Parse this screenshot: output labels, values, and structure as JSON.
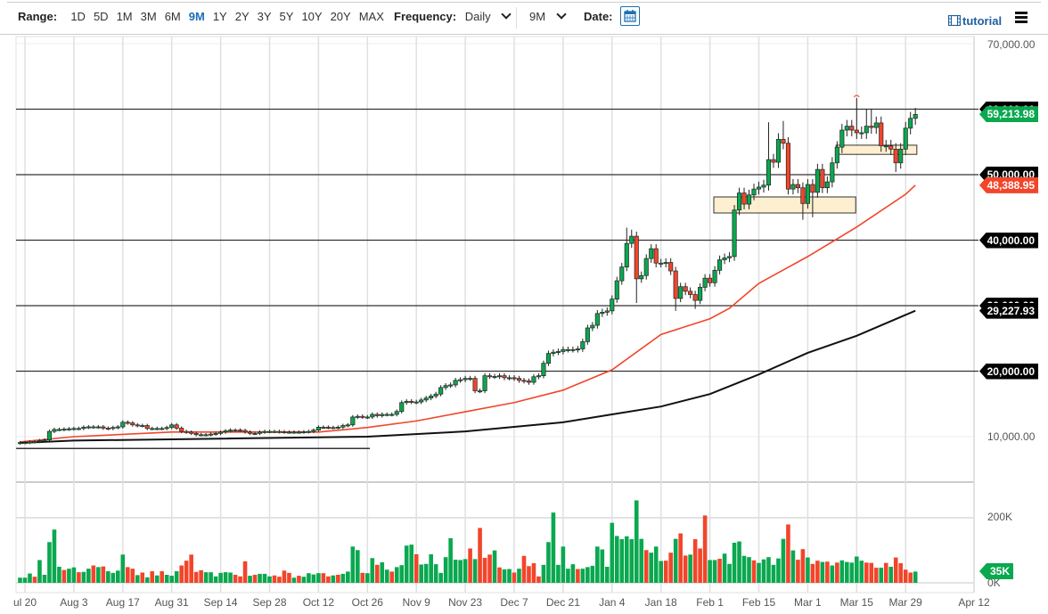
{
  "toolbar": {
    "range_label": "Range:",
    "range_options": [
      "1D",
      "5D",
      "1M",
      "3M",
      "6M",
      "9M",
      "1Y",
      "2Y",
      "3Y",
      "5Y",
      "10Y",
      "20Y",
      "MAX"
    ],
    "range_selected": "9M",
    "frequency_label": "Frequency:",
    "frequency_value": "Daily",
    "period_value": "9M",
    "date_label": "Date:",
    "tutorial_label": "tutorial"
  },
  "colors": {
    "up": "#0aa84f",
    "down": "#f2452a",
    "accent": "#1c6fb5",
    "ma50": "#f2452a",
    "ma200": "#111111"
  },
  "chart_data": {
    "type": "candlestick",
    "unit": "thousands USD",
    "ylim": [
      0,
      72
    ],
    "start_index": -1,
    "closes": [
      9.1,
      9.1,
      9.2,
      9.25,
      9.4,
      9.5,
      10.8,
      11.1,
      11.1,
      11.15,
      11.2,
      11.25,
      11.25,
      11.45,
      11.5,
      11.5,
      11.5,
      11.3,
      11.25,
      11.4,
      11.5,
      12.2,
      12.1,
      11.8,
      11.7,
      11.7,
      11.25,
      11.25,
      11.25,
      11.25,
      11.4,
      11.8,
      11.3,
      10.8,
      10.7,
      10.5,
      10.3,
      10.3,
      10.3,
      10.4,
      10.5,
      10.7,
      10.9,
      11.0,
      11.0,
      10.95,
      10.7,
      10.5,
      10.5,
      10.7,
      10.8,
      10.8,
      10.8,
      10.75,
      10.7,
      10.7,
      10.7,
      10.7,
      10.75,
      10.8,
      11.0,
      11.45,
      11.45,
      11.4,
      11.4,
      11.45,
      11.7,
      11.8,
      13.0,
      13.1,
      13.0,
      13.0,
      13.4,
      13.2,
      13.4,
      13.4,
      13.4,
      13.85,
      15.2,
      15.4,
      15.3,
      15.3,
      15.6,
      15.9,
      16.2,
      16.5,
      17.5,
      17.8,
      17.9,
      18.6,
      18.7,
      18.9,
      18.9,
      17.0,
      17.0,
      19.3,
      19.2,
      19.2,
      19.3,
      19.0,
      19.0,
      18.9,
      18.6,
      18.5,
      18.3,
      19.15,
      19.3,
      21.2,
      22.7,
      22.9,
      23.0,
      23.3,
      23.3,
      23.3,
      23.4,
      24.5,
      26.6,
      27.0,
      28.8,
      29.0,
      29.2,
      31.0,
      33.8,
      35.9,
      39.5,
      40.6,
      34.1,
      34.6,
      37.2,
      38.7,
      36.5,
      36.5,
      36.6,
      35.3,
      31.1,
      32.9,
      32.2,
      31.7,
      30.8,
      32.8,
      34.2,
      33.5,
      35.4,
      37.0,
      37.3,
      37.5,
      44.6,
      47.2,
      45.5,
      46.9,
      47.8,
      48.1,
      48.4,
      52.3,
      51.9,
      55.4,
      54.8,
      47.8,
      48.5,
      48.0,
      45.6,
      48.5,
      47.3,
      50.8,
      48.0,
      48.9,
      51.8,
      54.2,
      56.8,
      57.4,
      56.8,
      56.4,
      56.4,
      57.4,
      57.2,
      57.9,
      54.4,
      54.4,
      53.9,
      51.8,
      53.9,
      57.1,
      58.6,
      59.2
    ],
    "first_open": 9.0,
    "notable_highs": {
      "123": 41.9,
      "124": 41.6,
      "152": 58.0,
      "155": 58.2,
      "170": 61.7,
      "172": 60.0,
      "173": 60.0
    },
    "notable_lows": {
      "125": 30.4,
      "133": 29.2,
      "137": 29.5,
      "159": 43.1,
      "161": 43.5,
      "178": 50.4
    },
    "volume_unit": "K",
    "volumes": [
      16,
      16,
      29,
      19,
      71,
      25,
      127,
      166,
      50,
      40,
      44,
      48,
      33,
      34,
      44,
      54,
      49,
      51,
      36,
      31,
      38,
      88,
      49,
      44,
      24,
      32,
      17,
      36,
      23,
      36,
      25,
      22,
      36,
      54,
      69,
      88,
      34,
      39,
      33,
      33,
      20,
      31,
      33,
      32,
      25,
      20,
      67,
      22,
      25,
      28,
      28,
      20,
      23,
      19,
      38,
      31,
      16,
      22,
      19,
      30,
      26,
      30,
      30,
      20,
      23,
      25,
      28,
      35,
      113,
      102,
      31,
      30,
      77,
      56,
      64,
      41,
      35,
      49,
      55,
      116,
      119,
      89,
      57,
      59,
      89,
      58,
      31,
      80,
      139,
      72,
      71,
      74,
      107,
      74,
      171,
      78,
      88,
      101,
      48,
      42,
      43,
      32,
      44,
      84,
      52,
      61,
      20,
      56,
      127,
      219,
      56,
      113,
      44,
      58,
      43,
      44,
      49,
      53,
      113,
      104,
      50,
      187,
      146,
      136,
      145,
      136,
      257,
      137,
      102,
      94,
      113,
      68,
      69,
      94,
      137,
      154,
      85,
      88,
      136,
      107,
      210,
      71,
      71,
      75,
      91,
      59,
      125,
      129,
      84,
      80,
      70,
      62,
      73,
      80,
      56,
      76,
      137,
      182,
      101,
      72,
      105,
      79,
      59,
      69,
      65,
      66,
      54,
      63,
      70,
      65,
      63,
      82,
      69,
      63,
      62,
      47,
      47,
      62,
      50,
      79,
      61,
      41,
      32,
      35
    ],
    "volume_colors": "gggrgggggrggrggrgrggggrrgrgrgrgggrrrrrggggggrrrgrgggrrrrgrggggrrgrggggrggrggrggggrggggggggggrgrrrgrggrgrrrrgggggggrgggggggggggggrgggrrgrrgrrrggrggggggrggggggrgrrgrrgrgrgggggrrrgrgrrrrgggg",
    "moving_averages": [
      {
        "name": "50-day SMA",
        "color": "#f2452a",
        "points": [
          [
            -1,
            9.2
          ],
          [
            10,
            10.0
          ],
          [
            30,
            10.7
          ],
          [
            60,
            10.7
          ],
          [
            70,
            11.4
          ],
          [
            80,
            12.4
          ],
          [
            90,
            13.8
          ],
          [
            100,
            15.2
          ],
          [
            110,
            17.1
          ],
          [
            120,
            20.2
          ],
          [
            130,
            25.6
          ],
          [
            140,
            28.0
          ],
          [
            144,
            29.6
          ],
          [
            150,
            33.4
          ],
          [
            160,
            37.5
          ],
          [
            170,
            42.0
          ],
          [
            180,
            47.0
          ],
          [
            182,
            48.39
          ]
        ]
      },
      {
        "name": "200-day SMA",
        "color": "#111111",
        "points": [
          [
            -1,
            9.05
          ],
          [
            10,
            9.4
          ],
          [
            40,
            9.7
          ],
          [
            70,
            10.0
          ],
          [
            90,
            10.8
          ],
          [
            110,
            12.2
          ],
          [
            120,
            13.4
          ],
          [
            130,
            14.6
          ],
          [
            140,
            16.5
          ],
          [
            150,
            19.5
          ],
          [
            160,
            22.8
          ],
          [
            170,
            25.4
          ],
          [
            182,
            29.23
          ]
        ]
      }
    ],
    "horizontal_levels": [
      60,
      50,
      40,
      30,
      20
    ],
    "support_line": {
      "price": 8.2,
      "from_index": -1.8,
      "to_index": 70.5
    },
    "zones": [
      {
        "from_index": 140.8,
        "to_index": 169.8,
        "low": 44.15,
        "high": 46.6
      },
      {
        "from_index": 165.8,
        "to_index": 182.3,
        "low": 53.1,
        "high": 54.5
      }
    ],
    "y_axis_labels": {
      "top": "70,000.00",
      "bottom": "10,000.00"
    },
    "price_tags": [
      {
        "text": "60,000.00",
        "value": 60,
        "kind": "level"
      },
      {
        "text": "59,213.98",
        "value": 59.21,
        "kind": "last"
      },
      {
        "text": "50,000.00",
        "value": 50,
        "kind": "level"
      },
      {
        "text": "48,388.95",
        "value": 48.39,
        "kind": "ma50"
      },
      {
        "text": "40,000.00",
        "value": 40,
        "kind": "level"
      },
      {
        "text": "30,000.00",
        "value": 30,
        "kind": "level"
      },
      {
        "text": "29,227.93",
        "value": 29.23,
        "kind": "ma200"
      },
      {
        "text": "20,000.00",
        "value": 20,
        "kind": "level"
      }
    ],
    "volume_axis": {
      "ticks": [
        {
          "label": "200K",
          "value": 200
        },
        {
          "label": "0K",
          "value": 0
        }
      ],
      "last_tag": "35K",
      "last_value": 35
    },
    "x_labels": [
      {
        "label": "ul 20",
        "index": 0
      },
      {
        "label": "Aug 3",
        "index": 10
      },
      {
        "label": "Aug 17",
        "index": 20
      },
      {
        "label": "Aug 31",
        "index": 30
      },
      {
        "label": "Sep 14",
        "index": 40
      },
      {
        "label": "Sep 28",
        "index": 50
      },
      {
        "label": "Oct 12",
        "index": 60
      },
      {
        "label": "Oct 26",
        "index": 70
      },
      {
        "label": "Nov 9",
        "index": 80
      },
      {
        "label": "Nov 23",
        "index": 90
      },
      {
        "label": "Dec 7",
        "index": 100
      },
      {
        "label": "Dec 21",
        "index": 110
      },
      {
        "label": "Jan 4",
        "index": 120
      },
      {
        "label": "Jan 18",
        "index": 130
      },
      {
        "label": "Feb 1",
        "index": 140
      },
      {
        "label": "Feb 15",
        "index": 150
      },
      {
        "label": "Mar 1",
        "index": 160
      },
      {
        "label": "Mar 15",
        "index": 170
      },
      {
        "label": "Mar 29",
        "index": 180
      },
      {
        "label": "Apr 12",
        "index": 194
      }
    ]
  }
}
